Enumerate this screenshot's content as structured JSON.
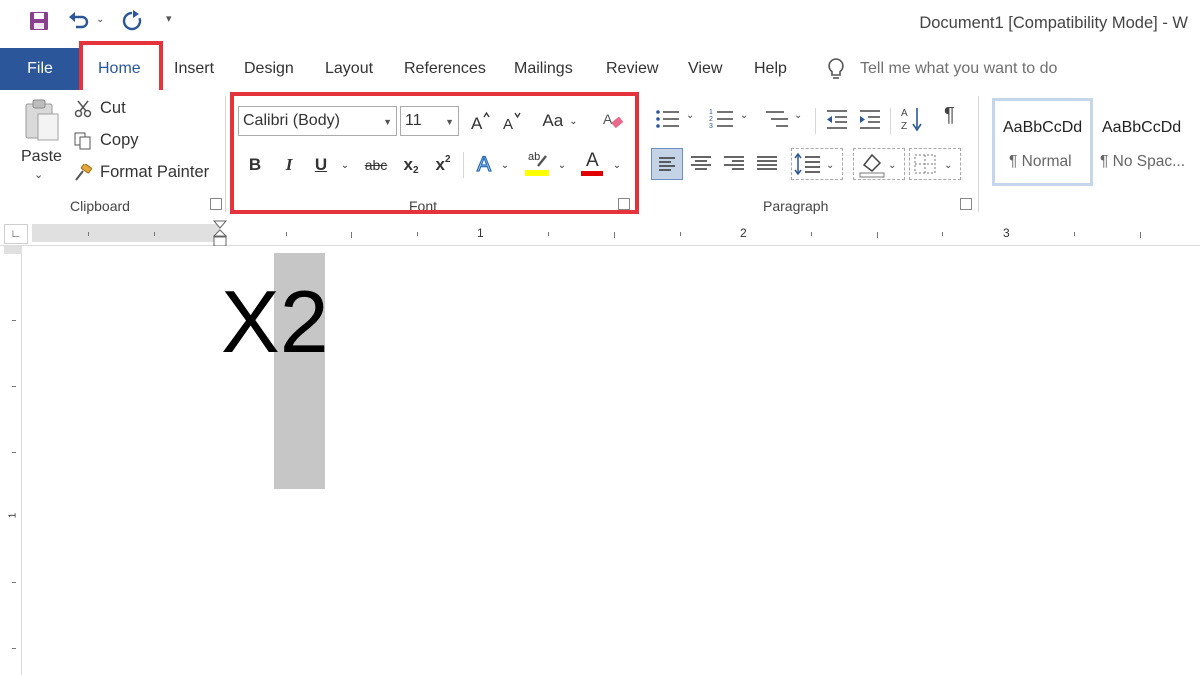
{
  "window": {
    "title": "Document1 [Compatibility Mode]  -  W"
  },
  "quick_access": {
    "save_icon": "save-icon",
    "undo_icon": "undo-icon",
    "redo_icon": "redo-icon",
    "customize_icon": "customize-qat-icon"
  },
  "tabs": {
    "file": "File",
    "home": "Home",
    "insert": "Insert",
    "design": "Design",
    "layout": "Layout",
    "references": "References",
    "mailings": "Mailings",
    "review": "Review",
    "view": "View",
    "help": "Help"
  },
  "tell_me": {
    "placeholder": "Tell me what you want to do",
    "icon": "lightbulb-icon"
  },
  "clipboard": {
    "paste": "Paste",
    "cut": "Cut",
    "copy": "Copy",
    "format_painter": "Format Painter",
    "group_label": "Clipboard"
  },
  "font": {
    "font_name": "Calibri (Body)",
    "font_size": "11",
    "change_case": "Aa",
    "bold": "B",
    "italic": "I",
    "underline": "U",
    "strikethrough": "abc",
    "subscript_base": "x",
    "subscript_sub": "2",
    "superscript_base": "x",
    "superscript_sup": "2",
    "text_effects": "A",
    "highlight_label": "ab",
    "font_color": "A",
    "group_label": "Font"
  },
  "paragraph": {
    "group_label": "Paragraph",
    "show_marks": "¶"
  },
  "styles": {
    "items": [
      {
        "sample": "AaBbCcDd",
        "name": "¶ Normal"
      },
      {
        "sample": "AaBbCcDd",
        "name": "¶ No Spac..."
      }
    ]
  },
  "ruler": {
    "labels": [
      "1",
      "2",
      "3"
    ],
    "vertical_label": "1"
  },
  "document": {
    "text": "X2"
  },
  "colors": {
    "accent": "#2b579a",
    "highlight_box": "#e5333b",
    "selection": "#c6c6c6",
    "highlight_yellow": "#ffff00",
    "font_color_red": "#e00000"
  }
}
